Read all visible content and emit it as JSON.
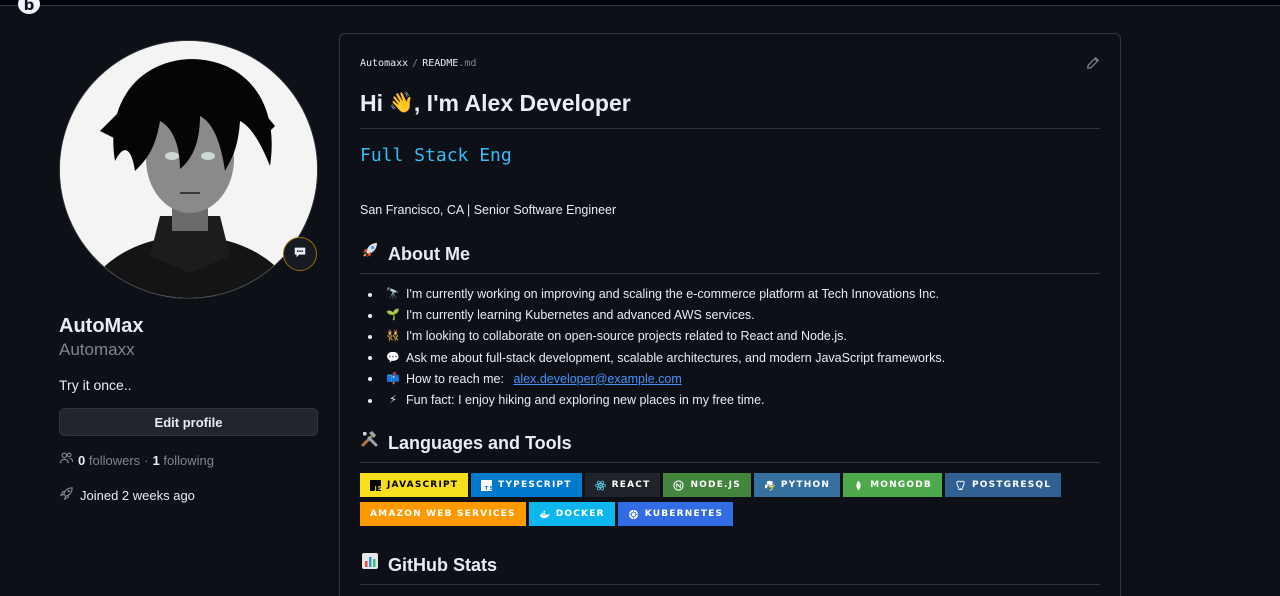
{
  "app": {
    "logo_letter": "b"
  },
  "profile": {
    "display_name": "AutoMax",
    "username": "Automaxx",
    "bio": "Try it once..",
    "edit_button": "Edit profile",
    "followers_count": "0",
    "followers_label": "followers",
    "dot": "·",
    "following_count": "1",
    "following_label": "following",
    "joined": "Joined 2 weeks ago"
  },
  "readme": {
    "breadcrumb_owner": "Automaxx",
    "breadcrumb_sep": "/",
    "breadcrumb_file": "README",
    "breadcrumb_ext": ".md",
    "heading_pre": "Hi",
    "heading_emoji": "👋",
    "heading_post": ", I'm Alex Developer",
    "typing_text": "Full Stack Eng",
    "location_line": "San Francisco, CA | Senior Software Engineer",
    "about_heading": "About Me",
    "about_items": [
      {
        "icon": "telescope-icon",
        "glyph": "🔭",
        "text": "I'm currently working on improving and scaling the e-commerce platform at Tech Innovations Inc."
      },
      {
        "icon": "seedling-icon",
        "glyph": "🌱",
        "text": "I'm currently learning Kubernetes and advanced AWS services."
      },
      {
        "icon": "people-icon",
        "glyph": "👯",
        "text": "I'm looking to collaborate on open-source projects related to React and Node.js."
      },
      {
        "icon": "speech-bubble-icon",
        "glyph": "💬",
        "text": "Ask me about full-stack development, scalable architectures, and modern JavaScript frameworks."
      },
      {
        "icon": "mailbox-icon",
        "glyph": "📫",
        "text": "How to reach me: ",
        "link": "alex.developer@example.com"
      },
      {
        "icon": "lightning-icon",
        "glyph": "⚡",
        "text": "Fun fact: I enjoy hiking and exploring new places in my free time."
      }
    ],
    "tools_heading": "Languages and Tools",
    "stats_heading": "GitHub Stats",
    "badges": [
      {
        "label": "JavaScript",
        "bg": "#f7df1e",
        "fg": "#000000",
        "icon": "javascript-icon"
      },
      {
        "label": "TypeScript",
        "bg": "#007acc",
        "fg": "#ffffff",
        "icon": "typescript-icon"
      },
      {
        "label": "React",
        "bg": "#20232a",
        "fg": "#ffffff",
        "icon": "react-icon"
      },
      {
        "label": "Node.js",
        "bg": "#43853d",
        "fg": "#ffffff",
        "icon": "nodejs-icon"
      },
      {
        "label": "Python",
        "bg": "#3670a0",
        "fg": "#ffffff",
        "icon": "python-icon"
      },
      {
        "label": "MongoDB",
        "bg": "#4ea94b",
        "fg": "#ffffff",
        "icon": "mongodb-icon"
      },
      {
        "label": "PostgreSQL",
        "bg": "#316192",
        "fg": "#ffffff",
        "icon": "postgresql-icon"
      },
      {
        "label": "Amazon Web Services",
        "bg": "#ff9900",
        "fg": "#ffffff",
        "icon": ""
      },
      {
        "label": "Docker",
        "bg": "#0db7ed",
        "fg": "#ffffff",
        "icon": "docker-icon"
      },
      {
        "label": "Kubernetes",
        "bg": "#326ce5",
        "fg": "#ffffff",
        "icon": "kubernetes-icon"
      }
    ]
  },
  "colors": {
    "background": "#0d1117",
    "border": "#30363d",
    "text": "#e6edf3",
    "muted": "#7d8590",
    "link": "#4493f8",
    "typing": "#36bcf7"
  }
}
